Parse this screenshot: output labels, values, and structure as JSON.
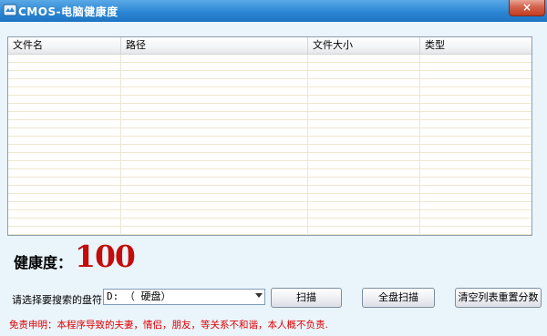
{
  "window": {
    "title": "CMOS-电脑健康度",
    "close_symbol": "×"
  },
  "file_list": {
    "columns": [
      "文件名",
      "路径",
      "文件大小",
      "类型"
    ],
    "rows": []
  },
  "health": {
    "label": "健康度：",
    "value": "100"
  },
  "drive": {
    "prompt": "请选择要搜索的盘符：",
    "selected": "D: （ 硬盘）"
  },
  "buttons": {
    "scan": "扫描",
    "full_scan": "全盘扫描",
    "clear_reset": "清空列表重置分数"
  },
  "disclaimer": "免责申明：本程序导致的夫妻，情侣，朋友，等关系不和谐，本人概不负责.",
  "colors": {
    "title_bar": "#2c86d4",
    "health_value": "#c40c0c",
    "disclaimer": "#e00000",
    "background": "#eaf4fb"
  }
}
